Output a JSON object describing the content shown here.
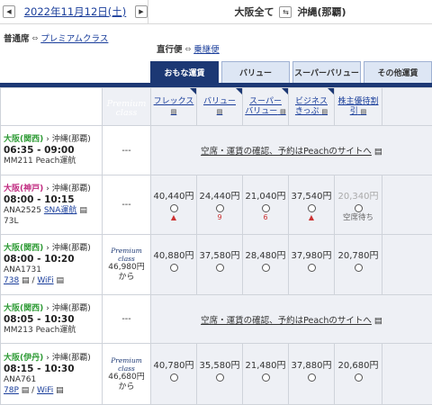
{
  "header": {
    "prev_icon": "◀",
    "date": "2022年11月12日(土)",
    "next_icon": "▶",
    "origin": "大阪全て",
    "swap_icon": "⇆",
    "destination": "沖縄(那覇)"
  },
  "filters": {
    "seat_label": "普通席",
    "seat_alt": "プレミアムクラス",
    "flight_label": "直行便",
    "flight_alt": "乗継便",
    "arrow_icon": "⇔"
  },
  "tabs": [
    {
      "label": "おもな運賃",
      "active": true
    },
    {
      "label": "バリュー",
      "active": false
    },
    {
      "label": "スーパーバリュー",
      "active": false
    },
    {
      "label": "その他運賃",
      "active": false
    }
  ],
  "fare_headers": {
    "premium_line1": "Premium",
    "premium_line2": "class",
    "cols": [
      {
        "l1": "フレックス",
        "l2": ""
      },
      {
        "l1": "バリュー",
        "l2": ""
      },
      {
        "l1": "スーパー",
        "l2": "バリュー"
      },
      {
        "l1": "ビジネス",
        "l2": "きっぷ"
      },
      {
        "l1": "株主優待割",
        "l2": "引"
      }
    ],
    "doc_icon": "▤"
  },
  "flights": [
    {
      "dep": "大阪(関西)",
      "arr": "沖縄(那覇)",
      "time": "06:35 - 09:00",
      "flight": "MM211  Peach運航",
      "extra": "",
      "aircraft": "",
      "premium": "---",
      "peach": true,
      "peach_text": "空席・運賃の確認、予約はPeachのサイトへ"
    },
    {
      "dep": "大阪(神戸)",
      "arr": "沖縄(那覇)",
      "time": "08:00 - 10:15",
      "flight": "ANA2525",
      "operator": "SNA運航",
      "extra": "73L",
      "aircraft": "",
      "premium": "---",
      "peach": false,
      "fares": [
        {
          "price": "40,440円",
          "mark": "▲",
          "gray": false
        },
        {
          "price": "24,440円",
          "mark": "9",
          "gray": false
        },
        {
          "price": "21,040円",
          "mark": "6",
          "gray": false
        },
        {
          "price": "37,540円",
          "mark": "▲",
          "gray": false
        },
        {
          "price": "20,340円",
          "mark": "空席待ち",
          "gray": true
        }
      ]
    },
    {
      "dep": "大阪(関西)",
      "arr": "沖縄(那覇)",
      "time": "08:00 - 10:20",
      "flight": "ANA1731",
      "extra": "",
      "aircraft": "738",
      "wifi": "WiFi",
      "premium_line1": "Premium class",
      "premium_price": "46,980円",
      "premium_from": "から",
      "peach": false,
      "fares": [
        {
          "price": "40,880円",
          "mark": "",
          "gray": false
        },
        {
          "price": "37,580円",
          "mark": "",
          "gray": false
        },
        {
          "price": "28,480円",
          "mark": "",
          "gray": false
        },
        {
          "price": "37,980円",
          "mark": "",
          "gray": false
        },
        {
          "price": "20,780円",
          "mark": "",
          "gray": false
        }
      ]
    },
    {
      "dep": "大阪(関西)",
      "arr": "沖縄(那覇)",
      "time": "08:05 - 10:30",
      "flight": "MM213  Peach運航",
      "extra": "",
      "aircraft": "",
      "premium": "---",
      "peach": true,
      "peach_text": "空席・運賃の確認、予約はPeachのサイトへ"
    },
    {
      "dep": "大阪(伊丹)",
      "arr": "沖縄(那覇)",
      "time": "08:15 - 10:30",
      "flight": "ANA761",
      "extra": "",
      "aircraft": "78P",
      "wifi": "WiFi",
      "premium_line1": "Premium class",
      "premium_price": "46,680円",
      "premium_from": "から",
      "peach": false,
      "fares": [
        {
          "price": "40,780円",
          "mark": "",
          "gray": false
        },
        {
          "price": "35,580円",
          "mark": "",
          "gray": false
        },
        {
          "price": "21,480円",
          "mark": "",
          "gray": false
        },
        {
          "price": "37,880円",
          "mark": "",
          "gray": false
        },
        {
          "price": "20,680円",
          "mark": "",
          "gray": false
        }
      ]
    }
  ],
  "colors": {
    "navy": "#1c3874",
    "link": "#1a3e9b",
    "kansai": "#2e9b35",
    "kobe": "#c0287f",
    "fare_bg": "#eef0f5",
    "mark_red": "#c33"
  }
}
